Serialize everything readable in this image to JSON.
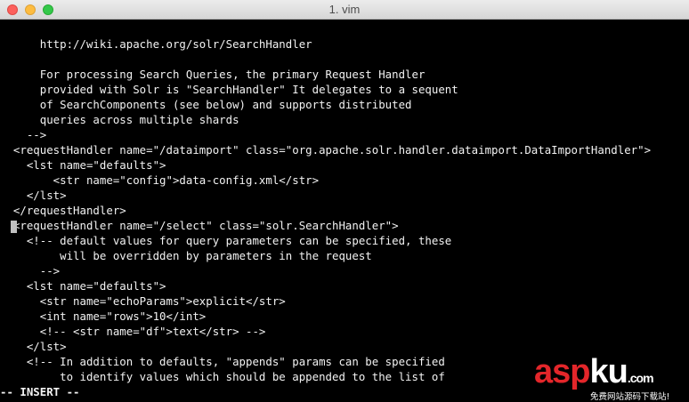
{
  "window": {
    "title": "1. vim"
  },
  "editor": {
    "lines": [
      "      http://wiki.apache.org/solr/SearchHandler",
      "",
      "      For processing Search Queries, the primary Request Handler",
      "      provided with Solr is \"SearchHandler\" It delegates to a sequent",
      "      of SearchComponents (see below) and supports distributed",
      "      queries across multiple shards",
      "    -->",
      "  <requestHandler name=\"/dataimport\" class=\"org.apache.solr.handler.dataimport.DataImportHandler\">",
      "    <lst name=\"defaults\">",
      "        <str name=\"config\">data-config.xml</str>",
      "    </lst>",
      "  </requestHandler>",
      "  <requestHandler name=\"/select\" class=\"solr.SearchHandler\">",
      "    <!-- default values for query parameters can be specified, these",
      "         will be overridden by parameters in the request",
      "      -->",
      "    <lst name=\"defaults\">",
      "      <str name=\"echoParams\">explicit</str>",
      "      <int name=\"rows\">10</int>",
      "      <!-- <str name=\"df\">text</str> -->",
      "    </lst>",
      "    <!-- In addition to defaults, \"appends\" params can be specified",
      "         to identify values which should be appended to the list of"
    ],
    "status": "-- INSERT --"
  },
  "watermark": {
    "logo_red": "asp",
    "logo_white": "ku",
    "logo_suffix": ".com",
    "subtitle": "免费网站源码下载站!"
  }
}
